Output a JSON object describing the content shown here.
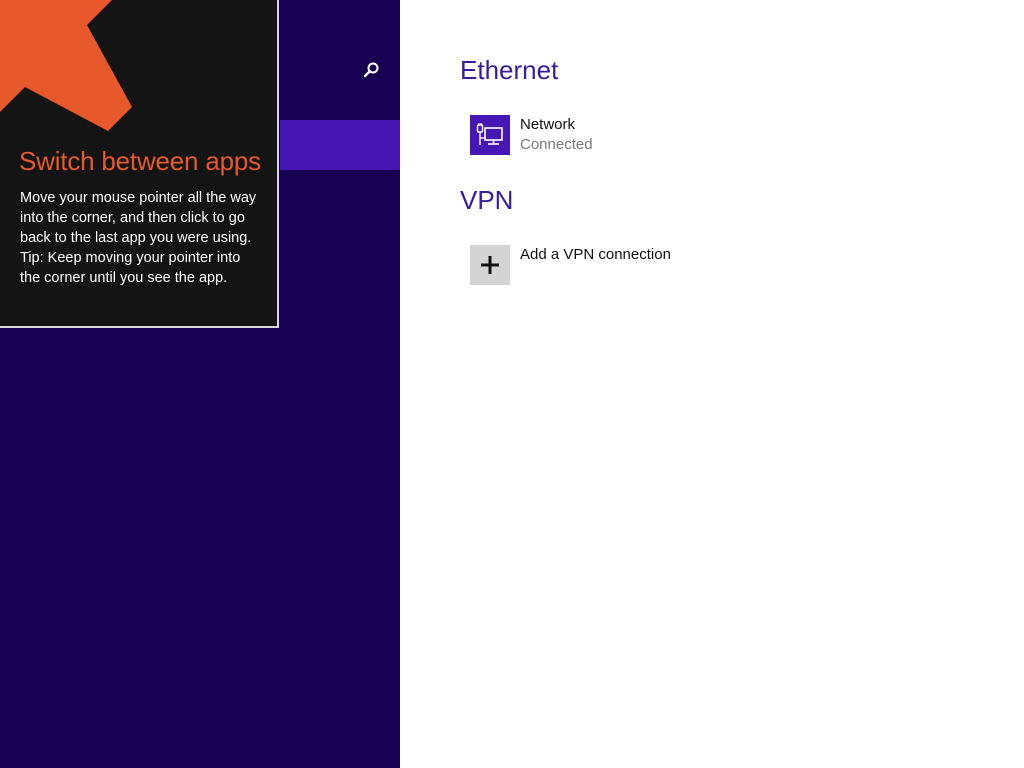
{
  "tip": {
    "title": "Switch between apps",
    "line1": "Move your mouse pointer all the way into the corner, and then click to go back to the last app you were using.",
    "line2": "Tip: Keep moving your pointer into the corner until you see the app.",
    "arrow_color": "#E7592B"
  },
  "nav": {
    "background": "#180052",
    "selected_color": "#4617B4",
    "search_icon": "search-icon"
  },
  "ethernet": {
    "heading": "Ethernet",
    "items": [
      {
        "name": "Network",
        "status": "Connected",
        "icon": "ethernet-network-icon"
      }
    ]
  },
  "vpn": {
    "heading": "VPN",
    "add_label": "Add a VPN connection",
    "icon": "plus-icon"
  },
  "colors": {
    "heading": "#3A1AA0",
    "accent": "#4617B4"
  }
}
